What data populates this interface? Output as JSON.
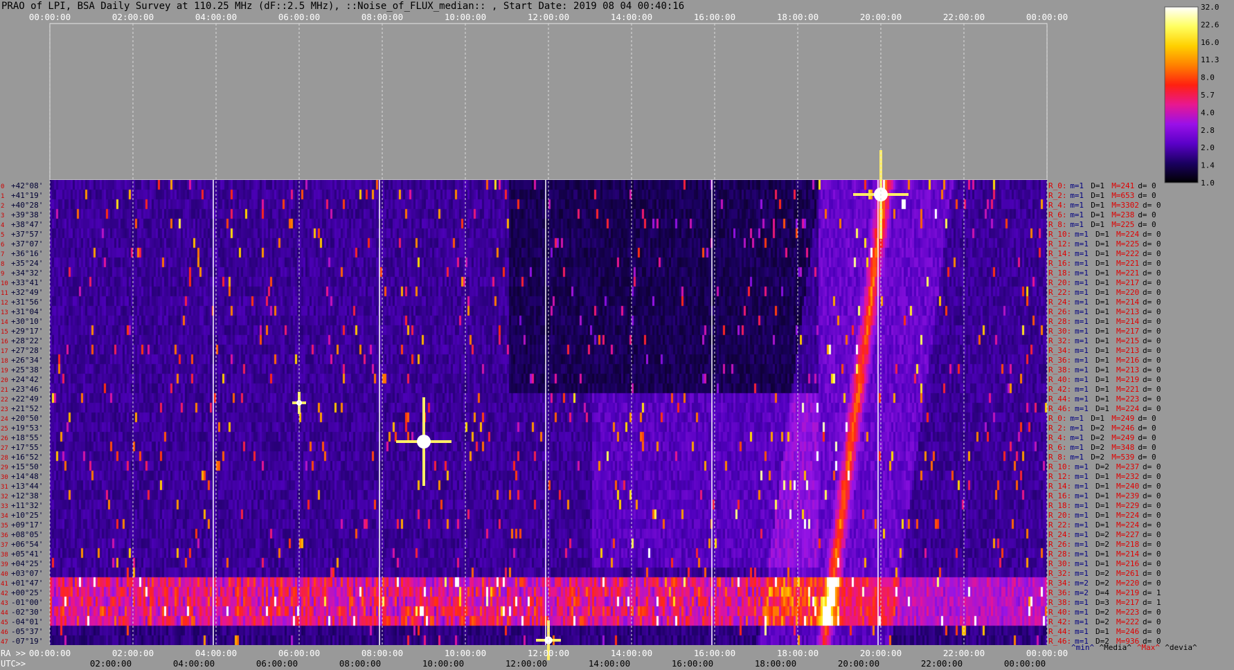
{
  "title": "PRAO of LPI, BSA Daily Survey at 110.25 MHz (dF::2.5 MHz), ::Noise_of_FLUX_median:: , Start Date: 2019 08 04 00:40:16",
  "chart_data": {
    "type": "heatmap",
    "top_axis_ticks": [
      "00:00:00",
      "02:00:00",
      "04:00:00",
      "06:00:00",
      "08:00:00",
      "10:00:00",
      "12:00:00",
      "14:00:00",
      "16:00:00",
      "18:00:00",
      "20:00:00",
      "22:00:00",
      "00:00:00"
    ],
    "ra_axis_prefix": "RA >>",
    "ra_axis_ticks": [
      "00:00:00",
      "02:00:00",
      "04:00:00",
      "06:00:00",
      "08:00:00",
      "10:00:00",
      "12:00:00",
      "14:00:00",
      "16:00:00",
      "18:00:00",
      "20:00:00",
      "22:00:00",
      "00:00:00"
    ],
    "utc_axis_prefix": "UTC>>",
    "utc_axis_ticks": [
      "02:00:00",
      "04:00:00",
      "06:00:00",
      "08:00:00",
      "10:00:00",
      "12:00:00",
      "14:00:00",
      "16:00:00",
      "18:00:00",
      "20:00:00",
      "22:00:00",
      "00:00:00"
    ],
    "declinations": [
      "+42°08'",
      "+41°19'",
      "+40°28'",
      "+39°38'",
      "+38°47'",
      "+37°57'",
      "+37°07'",
      "+36°16'",
      "+35°24'",
      "+34°32'",
      "+33°41'",
      "+32°49'",
      "+31°56'",
      "+31°04'",
      "+30°10'",
      "+29°17'",
      "+28°22'",
      "+27°28'",
      "+26°34'",
      "+25°38'",
      "+24°42'",
      "+23°46'",
      "+22°49'",
      "+21°52'",
      "+20°50'",
      "+19°53'",
      "+18°55'",
      "+17°55'",
      "+16°52'",
      "+15°50'",
      "+14°48'",
      "+13°44'",
      "+12°38'",
      "+11°32'",
      "+10°25'",
      "+09°17'",
      "+08°05'",
      "+06°54'",
      "+05°41'",
      "+04°25'",
      "+03°07'",
      "+01°47'",
      "+00°25'",
      "-01°00'",
      "-02°30'",
      "-04°01'",
      "-05°37'",
      "-07°19'"
    ],
    "row_stats": [
      {
        "r": "R_0:",
        "m": "1",
        "D": "1",
        "M": "241",
        "d": "0"
      },
      {
        "r": "R_2:",
        "m": "1",
        "D": "1",
        "M": "653",
        "d": "0"
      },
      {
        "r": "R_4:",
        "m": "1",
        "D": "1",
        "M": "3302",
        "d": "0"
      },
      {
        "r": "R_6:",
        "m": "1",
        "D": "1",
        "M": "238",
        "d": "0"
      },
      {
        "r": "R_8:",
        "m": "1",
        "D": "1",
        "M": "225",
        "d": "0"
      },
      {
        "r": "R_10:",
        "m": "1",
        "D": "1",
        "M": "224",
        "d": "0"
      },
      {
        "r": "R_12:",
        "m": "1",
        "D": "1",
        "M": "225",
        "d": "0"
      },
      {
        "r": "R_14:",
        "m": "1",
        "D": "1",
        "M": "222",
        "d": "0"
      },
      {
        "r": "R_16:",
        "m": "1",
        "D": "1",
        "M": "221",
        "d": "0"
      },
      {
        "r": "R_18:",
        "m": "1",
        "D": "1",
        "M": "221",
        "d": "0"
      },
      {
        "r": "R_20:",
        "m": "1",
        "D": "1",
        "M": "217",
        "d": "0"
      },
      {
        "r": "R_22:",
        "m": "1",
        "D": "1",
        "M": "220",
        "d": "0"
      },
      {
        "r": "R_24:",
        "m": "1",
        "D": "1",
        "M": "214",
        "d": "0"
      },
      {
        "r": "R_26:",
        "m": "1",
        "D": "1",
        "M": "213",
        "d": "0"
      },
      {
        "r": "R_28:",
        "m": "1",
        "D": "1",
        "M": "214",
        "d": "0"
      },
      {
        "r": "R_30:",
        "m": "1",
        "D": "1",
        "M": "217",
        "d": "0"
      },
      {
        "r": "R_32:",
        "m": "1",
        "D": "1",
        "M": "215",
        "d": "0"
      },
      {
        "r": "R_34:",
        "m": "1",
        "D": "1",
        "M": "213",
        "d": "0"
      },
      {
        "r": "R_36:",
        "m": "1",
        "D": "1",
        "M": "216",
        "d": "0"
      },
      {
        "r": "R_38:",
        "m": "1",
        "D": "1",
        "M": "213",
        "d": "0"
      },
      {
        "r": "R_40:",
        "m": "1",
        "D": "1",
        "M": "219",
        "d": "0"
      },
      {
        "r": "R_42:",
        "m": "1",
        "D": "1",
        "M": "221",
        "d": "0"
      },
      {
        "r": "R_44:",
        "m": "1",
        "D": "1",
        "M": "223",
        "d": "0"
      },
      {
        "r": "R_46:",
        "m": "1",
        "D": "1",
        "M": "224",
        "d": "0"
      },
      {
        "r": "R_0:",
        "m": "1",
        "D": "1",
        "M": "249",
        "d": "0"
      },
      {
        "r": "R_2:",
        "m": "1",
        "D": "2",
        "M": "246",
        "d": "0"
      },
      {
        "r": "R_4:",
        "m": "1",
        "D": "2",
        "M": "249",
        "d": "0"
      },
      {
        "r": "R_6:",
        "m": "1",
        "D": "2",
        "M": "348",
        "d": "0"
      },
      {
        "r": "R_8:",
        "m": "1",
        "D": "2",
        "M": "539",
        "d": "0"
      },
      {
        "r": "R_10:",
        "m": "1",
        "D": "2",
        "M": "237",
        "d": "0"
      },
      {
        "r": "R_12:",
        "m": "1",
        "D": "1",
        "M": "232",
        "d": "0"
      },
      {
        "r": "R_14:",
        "m": "1",
        "D": "1",
        "M": "240",
        "d": "0"
      },
      {
        "r": "R_16:",
        "m": "1",
        "D": "1",
        "M": "239",
        "d": "0"
      },
      {
        "r": "R_18:",
        "m": "1",
        "D": "1",
        "M": "229",
        "d": "0"
      },
      {
        "r": "R_20:",
        "m": "1",
        "D": "1",
        "M": "224",
        "d": "0"
      },
      {
        "r": "R_22:",
        "m": "1",
        "D": "1",
        "M": "224",
        "d": "0"
      },
      {
        "r": "R_24:",
        "m": "1",
        "D": "2",
        "M": "227",
        "d": "0"
      },
      {
        "r": "R_26:",
        "m": "1",
        "D": "2",
        "M": "218",
        "d": "0"
      },
      {
        "r": "R_28:",
        "m": "1",
        "D": "1",
        "M": "214",
        "d": "0"
      },
      {
        "r": "R_30:",
        "m": "1",
        "D": "1",
        "M": "216",
        "d": "0"
      },
      {
        "r": "R_32:",
        "m": "1",
        "D": "2",
        "M": "261",
        "d": "0"
      },
      {
        "r": "R_34:",
        "m": "2",
        "D": "2",
        "M": "220",
        "d": "0"
      },
      {
        "r": "R_36:",
        "m": "2",
        "D": "4",
        "M": "219",
        "d": "1"
      },
      {
        "r": "R_38:",
        "m": "1",
        "D": "3",
        "M": "217",
        "d": "1"
      },
      {
        "r": "R_40:",
        "m": "1",
        "D": "2",
        "M": "223",
        "d": "0"
      },
      {
        "r": "R_42:",
        "m": "1",
        "D": "2",
        "M": "222",
        "d": "0"
      },
      {
        "r": "R_44:",
        "m": "1",
        "D": "1",
        "M": "246",
        "d": "0"
      },
      {
        "r": "R_46:",
        "m": "1",
        "D": "2",
        "M": "936",
        "d": "0"
      }
    ],
    "stat_labels": {
      "m": "m=",
      "D": "D=",
      "M": "M=",
      "d": "d= "
    },
    "legend_keys": [
      "^min^",
      "^Media^",
      "^Max^",
      "^devia^"
    ],
    "colorbar": {
      "ticks": [
        "32.0",
        "22.6",
        "16.0",
        "11.3",
        "8.0",
        "5.7",
        "4.0",
        "2.8",
        "2.0",
        "1.4",
        "1.0"
      ],
      "colors": [
        "#000000",
        "#1a0060",
        "#5a00c8",
        "#9a10e8",
        "#e81890",
        "#ff2010",
        "#ff8000",
        "#ffd000",
        "#ffff60",
        "#ffffff"
      ]
    },
    "features": {
      "bright_sources": [
        {
          "ra_h": 20.0,
          "row": 1.5,
          "size": "large"
        },
        {
          "ra_h": 9.0,
          "row": 27,
          "size": "large"
        },
        {
          "ra_h": 12.0,
          "row": 47.5,
          "size": "medium"
        },
        {
          "ra_h": 6.0,
          "row": 23,
          "size": "small"
        }
      ],
      "galactic_band_rows": [
        41,
        45
      ],
      "galactic_plane": "diagonal track from RA 18.6h (bottom) to RA 20.1h (top)"
    }
  }
}
